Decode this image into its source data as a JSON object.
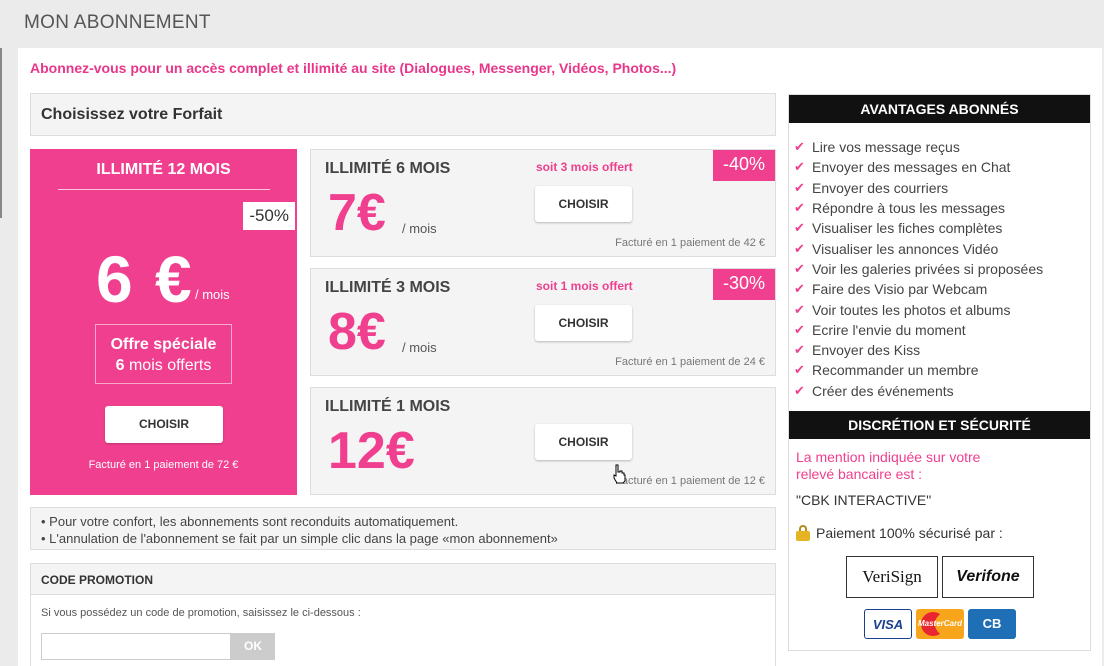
{
  "header": {
    "title": "MON ABONNEMENT"
  },
  "tagline": "Abonnez-vous pour un accès complet et illimité au site (Dialogues, Messenger, Vidéos, Photos...)",
  "forfait_heading": "Choisissez votre Forfait",
  "featured_plan": {
    "title": "ILLIMITÉ 12 MOIS",
    "discount": "-50%",
    "price": "6 €",
    "per": "/ mois",
    "offer_line1": "Offre spéciale",
    "offer_line2_num": "6",
    "offer_line2_text": "mois offerts",
    "button": "CHOISIR",
    "billing": "Facturé en 1 paiement de 72 €"
  },
  "plans": [
    {
      "title": "ILLIMITÉ 6 MOIS",
      "offer": "soit 3 mois offert",
      "discount": "-40%",
      "price": "7€",
      "per": "/ mois",
      "button": "CHOISIR",
      "billing": "Facturé en 1 paiement de 42 €"
    },
    {
      "title": "ILLIMITÉ 3 MOIS",
      "offer": "soit 1 mois offert",
      "discount": "-30%",
      "price": "8€",
      "per": "/ mois",
      "button": "CHOISIR",
      "billing": "Facturé en 1 paiement de 24 €"
    },
    {
      "title": "ILLIMITÉ 1 MOIS",
      "price": "12€",
      "button": "CHOISIR",
      "billing": "Facturé en 1 paiement de 12 €"
    }
  ],
  "notes": [
    "• Pour votre confort, les abonnements sont reconduits automatiquement.",
    "• L'annulation de l'abonnement se fait par un simple clic dans la page «mon abonnement»"
  ],
  "promo": {
    "heading": "CODE PROMOTION",
    "text": "Si vous possédez un code de promotion, saisissez le ci-dessous :",
    "input_value": "",
    "button": "OK"
  },
  "sidebar": {
    "avantages_title": "AVANTAGES ABONNÉS",
    "avantages": [
      "Lire vos message reçus",
      "Envoyer des messages en Chat",
      "Envoyer des courriers",
      "Répondre à tous les messages",
      "Visualiser les fiches complètes",
      "Visualiser les annonces Vidéo",
      "Voir les galeries privées si proposées",
      "Faire des Visio par Webcam",
      "Voir toutes les photos et albums",
      "Ecrire l'envie du moment",
      "Envoyer des Kiss",
      "Recommander un membre",
      "Créer des événements"
    ],
    "security_title": "DISCRÉTION ET SÉCURITÉ",
    "mention": "La mention indiquée sur votre relevé bancaire est :",
    "company": "\"CBK INTERACTIVE\"",
    "secure_text": "Paiement 100% sécurisé par :",
    "logos": {
      "verisign": "VeriSign",
      "verifone": "Verifone"
    },
    "cards": {
      "visa": "VISA",
      "mastercard": "MasterCard",
      "cb": "CB"
    }
  },
  "colors": {
    "accent": "#ef3f8e",
    "dark": "#111111"
  }
}
